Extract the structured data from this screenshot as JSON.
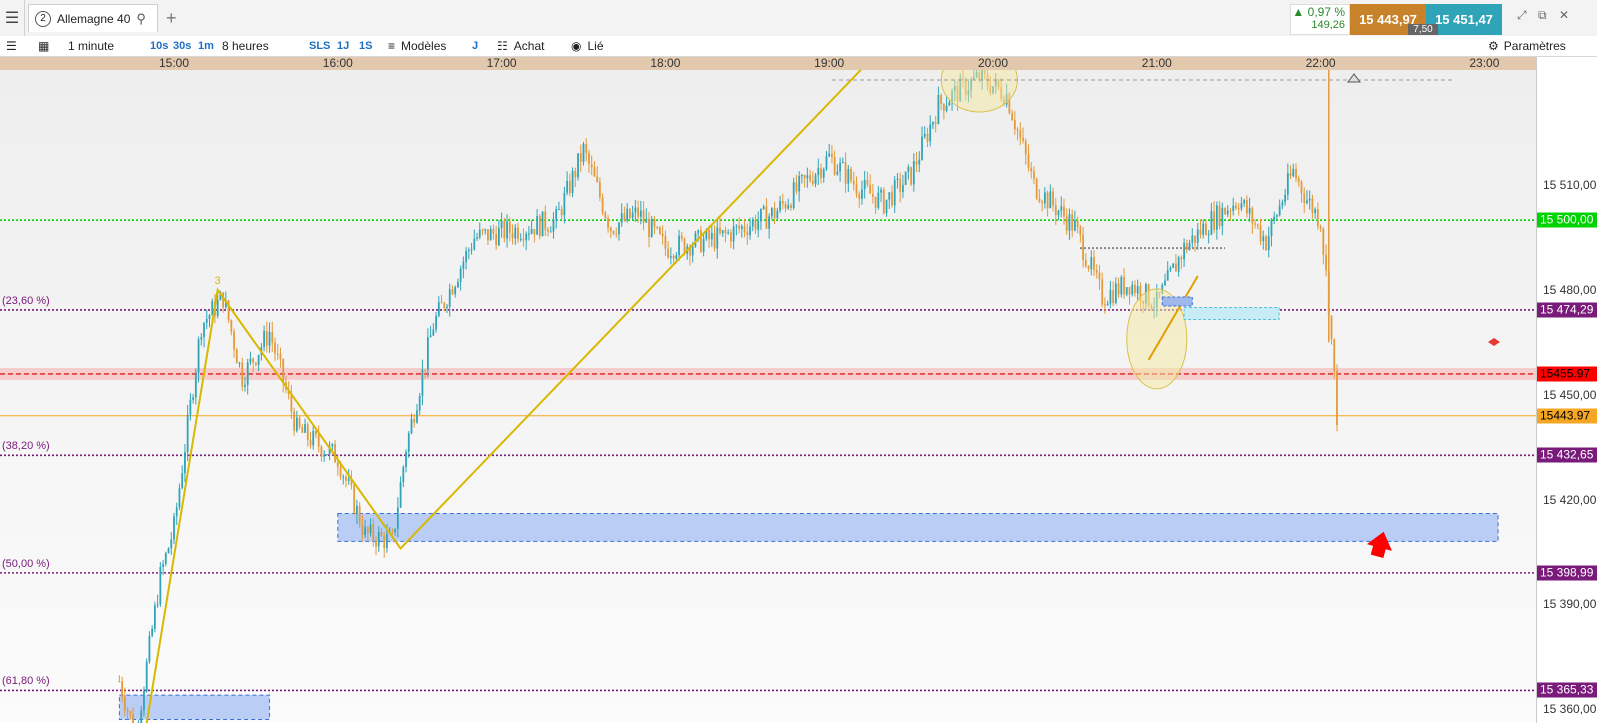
{
  "app": {
    "menu_icon": "hamburger-menu-icon",
    "tab": {
      "number": "2",
      "title": "Allemagne 40",
      "search_icon": "search-icon"
    },
    "add_tab_icon": "plus-icon"
  },
  "quote": {
    "change_pct": "0,97 %",
    "change_pts": "149,26",
    "bid": "15 443,97",
    "ask": "15 451,47",
    "spread": "7,50",
    "bid_color": "#c8832a",
    "ask_color": "#2fa4b8"
  },
  "toolbar": {
    "list_icon": "list-icon",
    "layout_icon": "layout-grid-icon",
    "interval": "1 minute",
    "quick_intervals": [
      "10s",
      "30s",
      "1m"
    ],
    "range": "8 heures",
    "quick_ranges": [
      "SLS",
      "1J",
      "1S"
    ],
    "templates": "Modèles",
    "j_label": "J",
    "buy": "Achat",
    "linked": "Lié",
    "settings": "Paramètres"
  },
  "chart_data": {
    "type": "candlestick",
    "instrument": "Allemagne 40",
    "x_ticks": [
      "15:00",
      "16:00",
      "17:00",
      "18:00",
      "19:00",
      "20:00",
      "21:00",
      "22:00",
      "23:00"
    ],
    "y_ticks": [
      "15 510,00",
      "15 480,00",
      "15 450,00",
      "15 420,00",
      "15 390,00",
      "15 360,00"
    ],
    "y_tick_values": [
      15510,
      15480,
      15450,
      15420,
      15390,
      15360
    ],
    "ylim": [
      15356,
      15543
    ],
    "price_path": [
      [
        "14:40",
        15368
      ],
      [
        "14:46",
        15352
      ],
      [
        "14:55",
        15398
      ],
      [
        "15:00",
        15412
      ],
      [
        "15:10",
        15470
      ],
      [
        "15:18",
        15478
      ],
      [
        "15:25",
        15455
      ],
      [
        "15:35",
        15468
      ],
      [
        "15:45",
        15440
      ],
      [
        "16:00",
        15432
      ],
      [
        "16:10",
        15410
      ],
      [
        "16:20",
        15408
      ],
      [
        "16:25",
        15435
      ],
      [
        "16:35",
        15470
      ],
      [
        "16:50",
        15495
      ],
      [
        "17:10",
        15498
      ],
      [
        "17:20",
        15500
      ],
      [
        "17:30",
        15520
      ],
      [
        "17:40",
        15498
      ],
      [
        "17:50",
        15502
      ],
      [
        "18:00",
        15492
      ],
      [
        "18:20",
        15495
      ],
      [
        "18:40",
        15502
      ],
      [
        "19:00",
        15518
      ],
      [
        "19:10",
        15510
      ],
      [
        "19:20",
        15505
      ],
      [
        "19:30",
        15513
      ],
      [
        "19:40",
        15533
      ],
      [
        "19:55",
        15541
      ],
      [
        "20:05",
        15536
      ],
      [
        "20:15",
        15510
      ],
      [
        "20:30",
        15498
      ],
      [
        "20:40",
        15478
      ],
      [
        "20:50",
        15482
      ],
      [
        "21:00",
        15476
      ],
      [
        "21:10",
        15492
      ],
      [
        "21:20",
        15500
      ],
      [
        "21:30",
        15506
      ],
      [
        "21:40",
        15494
      ],
      [
        "21:50",
        15514
      ],
      [
        "21:55",
        15506
      ],
      [
        "22:00",
        15500
      ],
      [
        "22:03",
        15476
      ],
      [
        "22:06",
        15444
      ]
    ],
    "horizontal_levels": [
      {
        "label": "15 500,00",
        "value": 15500,
        "color": "#00d400",
        "style": "dotted",
        "box_bg": "#00d400",
        "box_fg": "#ffffff"
      },
      {
        "label": "15 474,29",
        "value": 15474.29,
        "color": "#7a1a7a",
        "style": "dotted",
        "fib": "(23,60 %)",
        "box_bg": "#7a1a7a",
        "box_fg": "#ffffff"
      },
      {
        "label": "15455.97",
        "value": 15455.97,
        "color": "#e53935",
        "style": "dashed",
        "box_bg": "#ff0000",
        "box_fg": "#000000"
      },
      {
        "label": "15443.97",
        "value": 15443.97,
        "color": "#f5a623",
        "style": "solid",
        "box_bg": "#f5a623",
        "box_fg": "#000000"
      },
      {
        "label": "15 432,65",
        "value": 15432.65,
        "color": "#7a1a7a",
        "style": "dotted",
        "fib": "(38,20 %)",
        "box_bg": "#7a1a7a",
        "box_fg": "#ffffff"
      },
      {
        "label": "15 398,99",
        "value": 15398.99,
        "color": "#7a1a7a",
        "style": "dotted",
        "fib": "(50,00 %)",
        "box_bg": "#7a1a7a",
        "box_fg": "#ffffff"
      },
      {
        "label": "15 365,33",
        "value": 15365.33,
        "color": "#7a1a7a",
        "style": "dotted",
        "fib": "(61,80 %)",
        "box_bg": "#7a1a7a",
        "box_fg": "#ffffff"
      }
    ],
    "annotations": {
      "wave_label": "3",
      "zigzag": [
        [
          "14:50",
          15356
        ],
        [
          "15:16",
          15480
        ],
        [
          "16:23",
          15406
        ],
        [
          "19:30",
          15558
        ]
      ],
      "zones": [
        {
          "from": "16:00",
          "to": "23:05",
          "low": 15408,
          "high": 15416
        },
        {
          "from": "14:40",
          "to": "15:35",
          "low": 15357,
          "high": 15364
        }
      ]
    }
  }
}
